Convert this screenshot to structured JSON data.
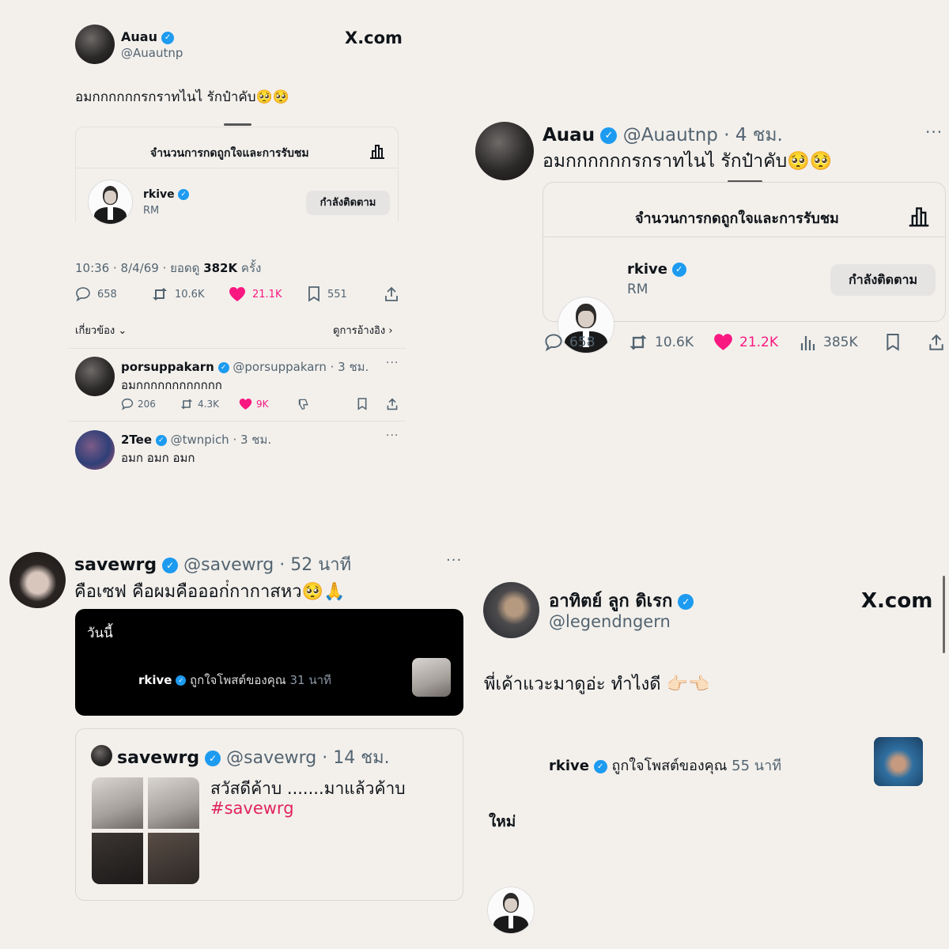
{
  "panel1": {
    "author_name": "Auau",
    "author_handle": "@Auautnp",
    "brand": "X.com",
    "text": "อมกกกกกกรกราทไนไ รักป๋าคับ🥺🥺",
    "card_header": "จำนวนการกดถูกใจและการรับชม",
    "liker_name": "rkive",
    "liker_sub": "RM",
    "follow_label": "กำลังติดตาม",
    "meta_time": "10:36 · 8/4/69 · ยอดดู",
    "meta_views": "382K",
    "meta_suffix": "ครั้ง",
    "stats": {
      "replies": "658",
      "reposts": "10.6K",
      "likes": "21.1K",
      "bookmarks": "551"
    },
    "related_label": "เกี่ยวข้อง",
    "quotes_label": "ดูการอ้างอิง",
    "replies": [
      {
        "name": "porsuppakarn",
        "handle": "@porsuppakarn · 3 ชม.",
        "text": "อมกกกกกกกกกกกก",
        "replies": "206",
        "reposts": "4.3K",
        "likes": "9K"
      },
      {
        "name": "2Tee",
        "handle": "@twnpich · 3 ชม.",
        "text": "อมก อมก อมก"
      }
    ]
  },
  "panel2": {
    "author_name": "Auau",
    "author_handle": "@Auautnp · 4 ชม.",
    "text": "อมกกกกกกรกราทไนไ รักป๋าคับ🥺🥺",
    "card_header": "จำนวนการกดถูกใจและการรับชม",
    "liker_name": "rkive",
    "liker_sub": "RM",
    "follow_label": "กำลังติดตาม",
    "stats": {
      "replies": "658",
      "reposts": "10.6K",
      "likes": "21.2K",
      "views": "385K"
    }
  },
  "panel3": {
    "author_name": "savewrg",
    "author_handle": "@savewrg · 52 นาที",
    "text": "คือเซฟ คือผมคือออก่ํกากาสหว🥺🙏",
    "notif_today": "วันนี้",
    "notif_name": "rkive",
    "notif_text": "ถูกใจโพสต์ของคุณ",
    "notif_time": "31 นาที",
    "quote_name": "savewrg",
    "quote_handle": "@savewrg · 14 ชม.",
    "quote_text": "สวัสดีค้าบ .......มาแล้วค้าบ",
    "quote_hashtag": "#savewrg"
  },
  "panel4": {
    "author_name": "อาทิตย์ ลูก ดิเรก",
    "author_handle": "@legendngern",
    "brand": "X.com",
    "text": "พี่เค้าแวะมาดูอ่ะ ทำไงดี 👉🏻👈🏻",
    "notif_name": "rkive",
    "notif_text": "ถูกใจโพสต์ของคุณ",
    "notif_time": "55 นาที",
    "footer": "ใหม่"
  },
  "colors": {
    "like": "#f91880",
    "verified": "#1d9bf0",
    "hashtag": "#e0245e",
    "bg": "#f3f0ec"
  }
}
